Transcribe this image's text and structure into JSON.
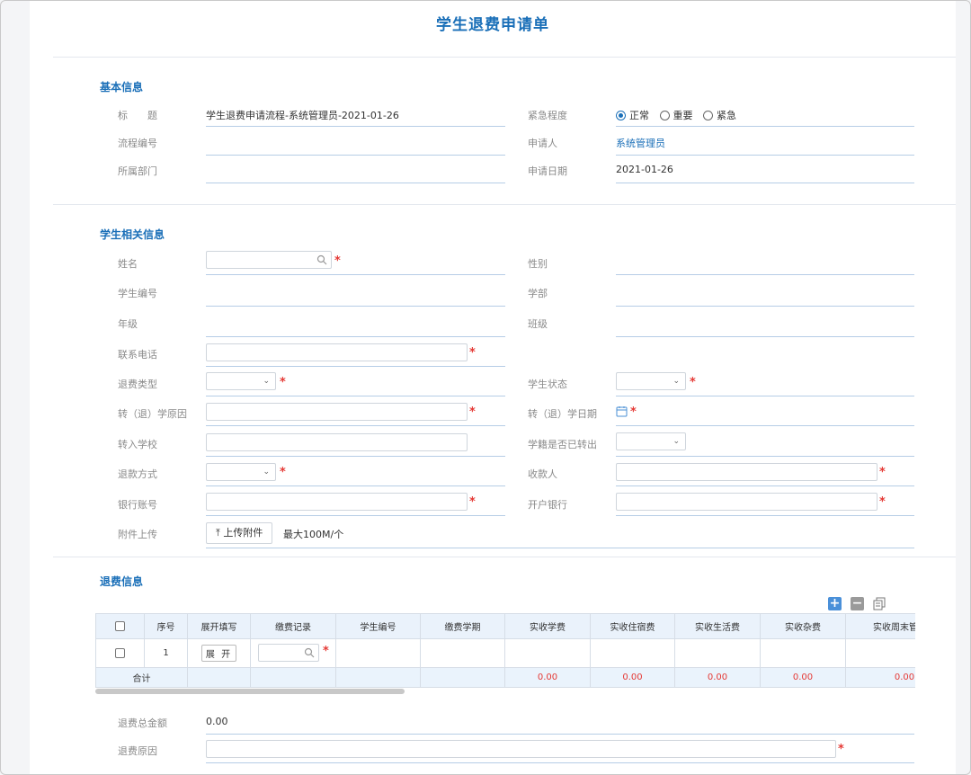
{
  "title": "学生退费申请单",
  "basic": {
    "section_title": "基本信息",
    "subject_label": "标　　题",
    "subject_value": "学生退费申请流程-系统管理员-2021-01-26",
    "urgency_label": "紧急程度",
    "urgency_options": [
      "正常",
      "重要",
      "紧急"
    ],
    "urgency_selected": "正常",
    "flow_no_label": "流程编号",
    "applicant_label": "申请人",
    "applicant_value": "系统管理员",
    "dept_label": "所属部门",
    "apply_date_label": "申请日期",
    "apply_date_value": "2021-01-26"
  },
  "student": {
    "section_title": "学生相关信息",
    "name_label": "姓名",
    "gender_label": "性别",
    "student_no_label": "学生编号",
    "faculty_label": "学部",
    "grade_label": "年级",
    "class_label": "班级",
    "phone_label": "联系电话",
    "refund_type_label": "退费类型",
    "status_label": "学生状态",
    "transfer_reason_label": "转（退）学原因",
    "transfer_date_label": "转（退）学日期",
    "transfer_school_label": "转入学校",
    "record_transferred_label": "学籍是否已转出",
    "refund_method_label": "退款方式",
    "payee_label": "收款人",
    "bank_account_label": "银行账号",
    "bank_label": "开户银行",
    "attachment_label": "附件上传",
    "upload_button": "上传附件",
    "upload_hint": "最大100M/个"
  },
  "refund": {
    "section_title": "退费信息",
    "columns": [
      "序号",
      "展开填写",
      "缴费记录",
      "学生编号",
      "缴费学期",
      "实收学费",
      "实收住宿费",
      "实收生活费",
      "实收杂费",
      "实收周末管理费"
    ],
    "rows": [
      {
        "index": "1",
        "expand": "展 开"
      }
    ],
    "sum_label": "合计",
    "sums": [
      "0.00",
      "0.00",
      "0.00",
      "0.00",
      "0.00"
    ],
    "total_label": "退费总金额",
    "total_value": "0.00",
    "reason_label": "退费原因"
  },
  "required_mark": "*",
  "colors": {
    "accent": "#1a6fb8",
    "required": "#e53935",
    "underline": "#b6cde6"
  }
}
